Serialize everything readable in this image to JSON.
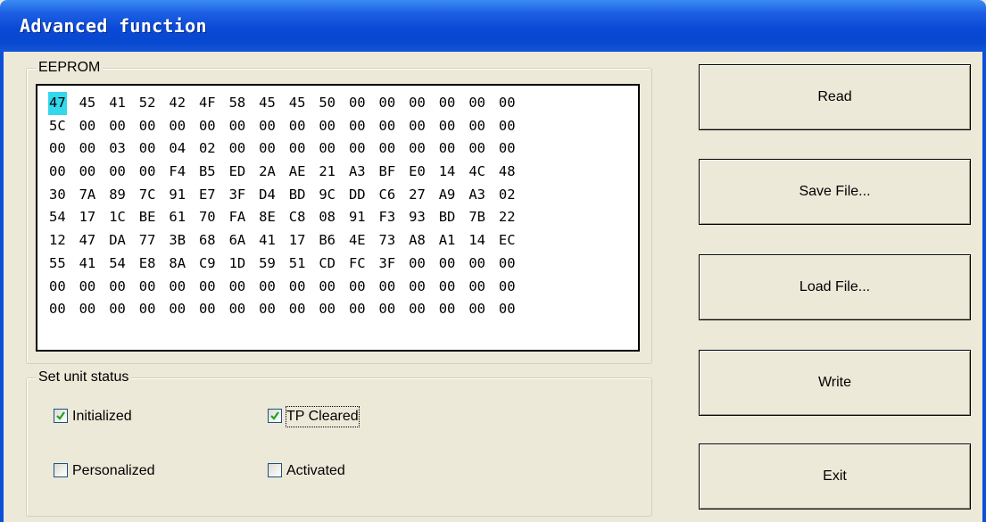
{
  "window": {
    "title": "Advanced function"
  },
  "eeprom": {
    "label": "EEPROM",
    "selected": {
      "row": 0,
      "col": 0
    },
    "rows": [
      [
        "47",
        "45",
        "41",
        "52",
        "42",
        "4F",
        "58",
        "45",
        "45",
        "50",
        "00",
        "00",
        "00",
        "00",
        "00",
        "00"
      ],
      [
        "5C",
        "00",
        "00",
        "00",
        "00",
        "00",
        "00",
        "00",
        "00",
        "00",
        "00",
        "00",
        "00",
        "00",
        "00",
        "00"
      ],
      [
        "00",
        "00",
        "03",
        "00",
        "04",
        "02",
        "00",
        "00",
        "00",
        "00",
        "00",
        "00",
        "00",
        "00",
        "00",
        "00"
      ],
      [
        "00",
        "00",
        "00",
        "00",
        "F4",
        "B5",
        "ED",
        "2A",
        "AE",
        "21",
        "A3",
        "BF",
        "E0",
        "14",
        "4C",
        "48"
      ],
      [
        "30",
        "7A",
        "89",
        "7C",
        "91",
        "E7",
        "3F",
        "D4",
        "BD",
        "9C",
        "DD",
        "C6",
        "27",
        "A9",
        "A3",
        "02"
      ],
      [
        "54",
        "17",
        "1C",
        "BE",
        "61",
        "70",
        "FA",
        "8E",
        "C8",
        "08",
        "91",
        "F3",
        "93",
        "BD",
        "7B",
        "22"
      ],
      [
        "12",
        "47",
        "DA",
        "77",
        "3B",
        "68",
        "6A",
        "41",
        "17",
        "B6",
        "4E",
        "73",
        "A8",
        "A1",
        "14",
        "EC"
      ],
      [
        "55",
        "41",
        "54",
        "E8",
        "8A",
        "C9",
        "1D",
        "59",
        "51",
        "CD",
        "FC",
        "3F",
        "00",
        "00",
        "00",
        "00"
      ],
      [
        "00",
        "00",
        "00",
        "00",
        "00",
        "00",
        "00",
        "00",
        "00",
        "00",
        "00",
        "00",
        "00",
        "00",
        "00",
        "00"
      ],
      [
        "00",
        "00",
        "00",
        "00",
        "00",
        "00",
        "00",
        "00",
        "00",
        "00",
        "00",
        "00",
        "00",
        "00",
        "00",
        "00"
      ]
    ]
  },
  "status": {
    "label": "Set unit status",
    "initialized": {
      "label": "Initialized",
      "checked": true
    },
    "tp_cleared": {
      "label": "TP Cleared",
      "checked": true
    },
    "personalized": {
      "label": "Personalized",
      "checked": false
    },
    "activated": {
      "label": "Activated",
      "checked": false
    }
  },
  "buttons": {
    "read": "Read",
    "save_file": "Save File...",
    "load_file": "Load File...",
    "write": "Write",
    "exit": "Exit"
  },
  "colors": {
    "title_bar": "#0a49d6",
    "selection": "#33d8ec",
    "dialog_bg": "#ece9d8",
    "check_mark": "#21a121"
  }
}
